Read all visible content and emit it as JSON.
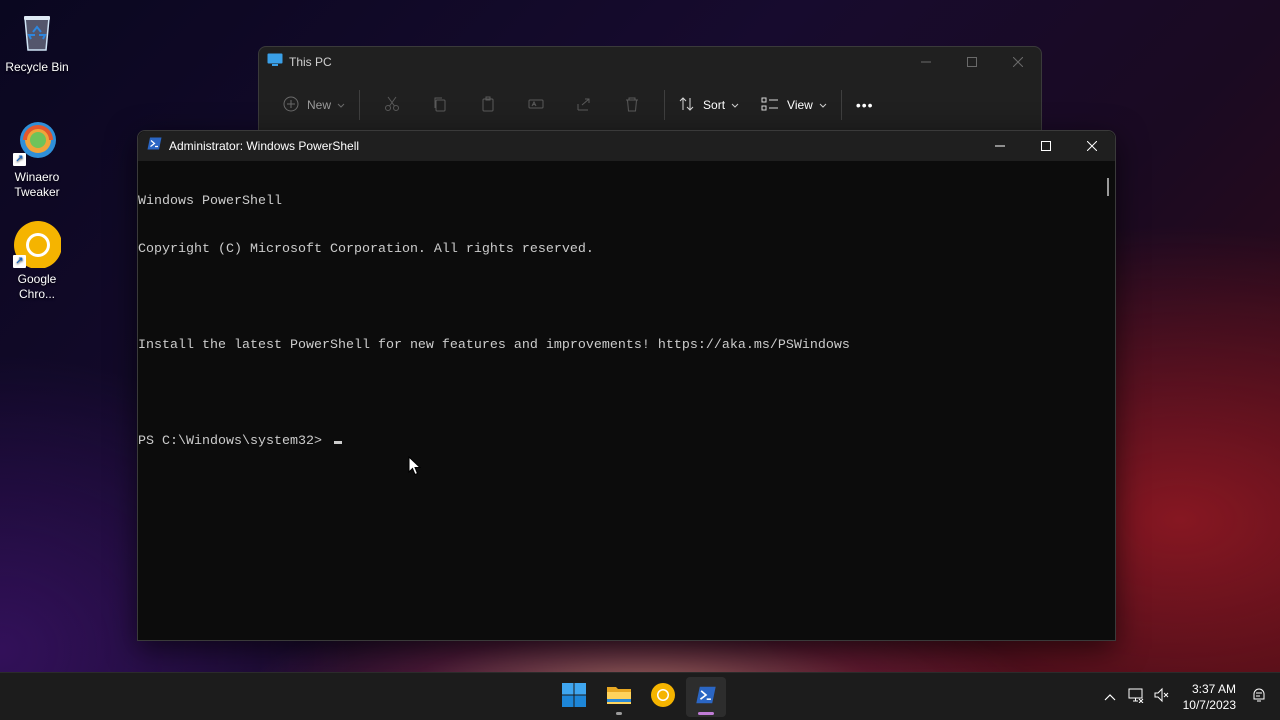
{
  "desktop": {
    "icons": [
      {
        "label": "Recycle Bin",
        "icon": "recycle-bin-icon"
      },
      {
        "label": "Winaero Tweaker",
        "icon": "winaero-tweaker-icon"
      },
      {
        "label": "Google Chro...",
        "icon": "chrome-icon"
      }
    ]
  },
  "explorer": {
    "title": "This PC",
    "toolbar": {
      "new_label": "New",
      "sort_label": "Sort",
      "view_label": "View",
      "more_label": "•••"
    }
  },
  "powershell": {
    "title": "Administrator: Windows PowerShell",
    "lines": [
      "Windows PowerShell",
      "Copyright (C) Microsoft Corporation. All rights reserved.",
      "",
      "Install the latest PowerShell for new features and improvements! https://aka.ms/PSWindows",
      ""
    ],
    "prompt": "PS C:\\Windows\\system32> "
  },
  "taskbar": {
    "apps": [
      "start-icon",
      "file-explorer-icon",
      "chrome-icon",
      "powershell-icon"
    ],
    "clock": {
      "time": "3:37 AM",
      "date": "10/7/2023"
    }
  },
  "colors": {
    "terminal_bg": "#0c0c0c",
    "terminal_fg": "#cccccc",
    "running_indicator": "#c07cd6"
  }
}
